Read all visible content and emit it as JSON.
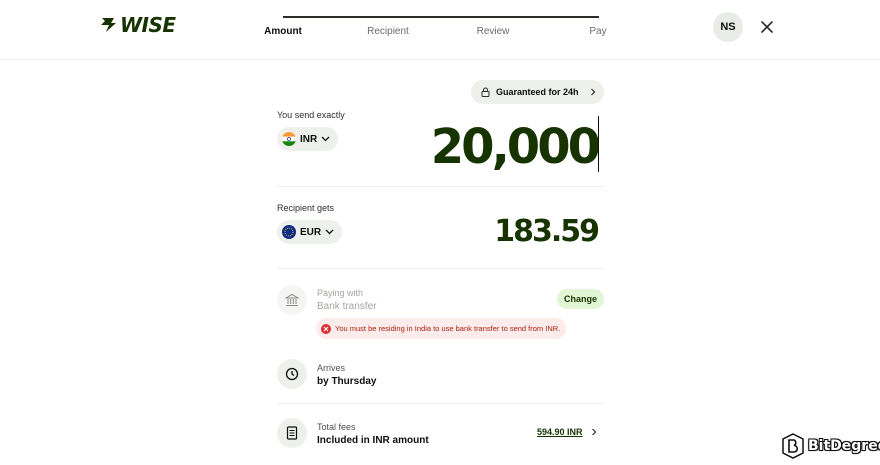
{
  "brand": {
    "name": "WISE",
    "color": "#163300",
    "accent": "#9fe870"
  },
  "stepper": {
    "steps": [
      "Amount",
      "Recipient",
      "Review",
      "Pay"
    ],
    "active_index": 0
  },
  "user": {
    "initials": "NS"
  },
  "guarantee": {
    "label": "Guaranteed for 24h"
  },
  "send": {
    "label": "You send exactly",
    "currency": "INR",
    "amount": "20,000"
  },
  "receive": {
    "label": "Recipient gets",
    "currency": "EUR",
    "amount": "183.59"
  },
  "paying_with": {
    "title": "Paying with",
    "method": "Bank transfer",
    "change_label": "Change",
    "error": "You must be residing in India to use bank transfer to send from INR."
  },
  "arrives": {
    "title": "Arrives",
    "value": "by Thursday"
  },
  "fees": {
    "title": "Total fees",
    "value": "Included in INR amount",
    "amount": "594.90 INR"
  },
  "watermark": {
    "text": "BitDegree"
  },
  "icons": [
    "wise-logo-icon",
    "close-icon",
    "lock-icon",
    "chevron-right-icon",
    "chevron-down-icon",
    "india-flag-icon",
    "eu-flag-icon",
    "bank-icon",
    "error-icon",
    "clock-icon",
    "receipt-icon",
    "bitdegree-logo-icon"
  ]
}
